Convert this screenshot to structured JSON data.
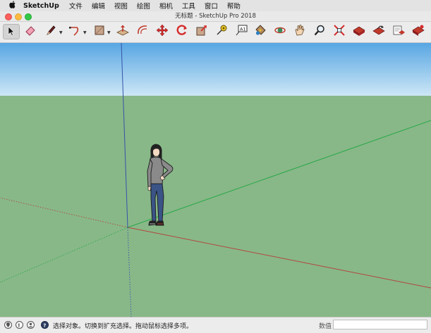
{
  "menubar": {
    "app_name": "SketchUp",
    "items": [
      "文件",
      "编辑",
      "视图",
      "绘图",
      "相机",
      "工具",
      "窗口",
      "帮助"
    ]
  },
  "window": {
    "title": "无标题 - SketchUp Pro 2018"
  },
  "toolbar": {
    "tools": [
      {
        "name": "select-tool",
        "icon": "arrow-cursor-icon"
      },
      {
        "name": "eraser-tool",
        "icon": "eraser-icon"
      },
      {
        "name": "line-tool",
        "icon": "pencil-icon"
      },
      {
        "name": "arc-tool",
        "icon": "arc-icon"
      },
      {
        "name": "rectangle-tool",
        "icon": "rectangle-icon"
      },
      {
        "name": "push-pull-tool",
        "icon": "push-pull-icon"
      },
      {
        "name": "offset-tool",
        "icon": "offset-icon"
      },
      {
        "name": "move-tool",
        "icon": "move-icon"
      },
      {
        "name": "rotate-tool",
        "icon": "rotate-icon"
      },
      {
        "name": "scale-tool",
        "icon": "scale-icon"
      },
      {
        "name": "tape-measure-tool",
        "icon": "tape-measure-icon"
      },
      {
        "name": "text-tool",
        "icon": "text-icon",
        "label": "A1"
      },
      {
        "name": "paint-bucket-tool",
        "icon": "paint-bucket-icon"
      },
      {
        "name": "orbit-tool",
        "icon": "orbit-icon"
      },
      {
        "name": "pan-tool",
        "icon": "hand-icon"
      },
      {
        "name": "zoom-tool",
        "icon": "magnifier-icon"
      },
      {
        "name": "zoom-extents-tool",
        "icon": "zoom-extents-icon"
      },
      {
        "name": "warehouse-tool",
        "icon": "warehouse-icon"
      },
      {
        "name": "share-model-tool",
        "icon": "share-model-icon"
      },
      {
        "name": "extension-warehouse-tool",
        "icon": "extension-warehouse-icon"
      },
      {
        "name": "layout-tool",
        "icon": "layout-icon"
      },
      {
        "name": "extension-manager-tool",
        "icon": "extension-manager-icon"
      }
    ]
  },
  "colors": {
    "sky_top": "#58a6e3",
    "sky_bottom": "#cde7f6",
    "ground": "#88b888",
    "axis_red": "#b2473f",
    "axis_green": "#2aa84a",
    "axis_blue": "#3553a8"
  },
  "statusbar": {
    "icons": [
      "geo-location-icon",
      "credits-icon",
      "user-icon",
      "help-icon"
    ],
    "message": "选择对象。切换到扩充选择。拖动鼠标选择多项。",
    "value_label": "数值",
    "value": ""
  }
}
